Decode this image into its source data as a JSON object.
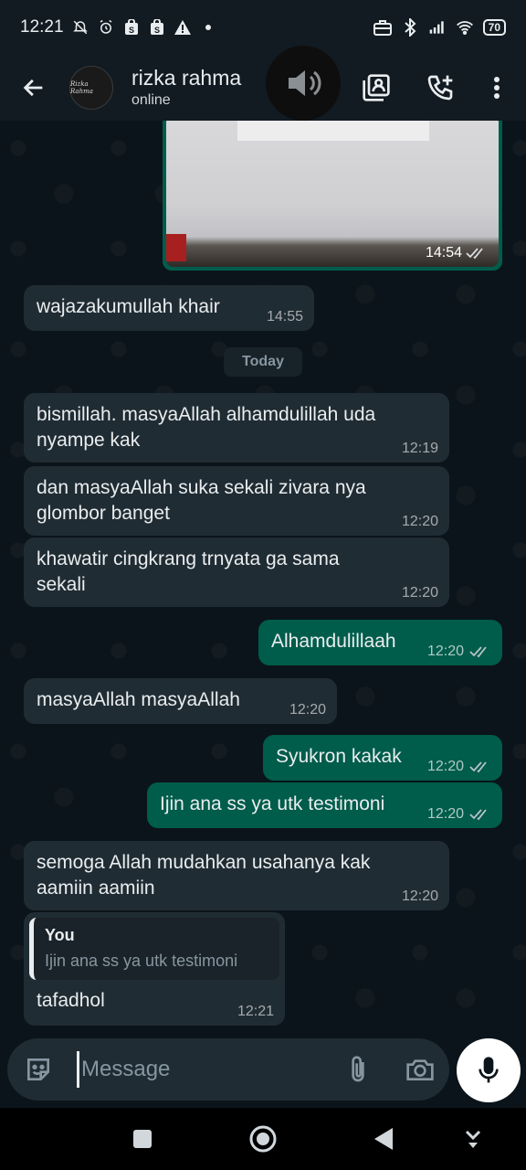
{
  "status_bar": {
    "time": "12:21",
    "battery": "70",
    "icons": [
      "mute-icon",
      "alarm-icon",
      "shop-icon",
      "shop-icon",
      "warning-icon",
      "dot-icon",
      "briefcase-icon",
      "bluetooth-icon",
      "signal-icon",
      "wifi-icon",
      "battery-icon"
    ]
  },
  "header": {
    "contact_name": "rizka rahma",
    "status": "online",
    "avatar_text": "Rizka Rahma",
    "icons": [
      "back-arrow-icon",
      "speaker-icon",
      "contact-card-icon",
      "add-call-icon",
      "more-vert-icon"
    ]
  },
  "chat": {
    "image_message": {
      "time": "14:54",
      "status": "read"
    },
    "messages": [
      {
        "dir": "in",
        "text": "wajazakumullah khair",
        "time": "14:55"
      },
      {
        "dir": "in",
        "text": "bismillah. masyaAllah alhamdulillah uda nyampe kak",
        "time": "12:19"
      },
      {
        "dir": "in",
        "text": "dan masyaAllah suka sekali zivara nya glombor banget",
        "time": "12:20"
      },
      {
        "dir": "in",
        "text": "khawatir cingkrang trnyata ga sama sekali",
        "time": "12:20"
      },
      {
        "dir": "out",
        "text": "Alhamdulillaah",
        "time": "12:20"
      },
      {
        "dir": "in",
        "text": "masyaAllah masyaAllah",
        "time": "12:20"
      },
      {
        "dir": "out",
        "text": "Syukron kakak",
        "time": "12:20"
      },
      {
        "dir": "out",
        "text": "Ijin ana ss ya utk testimoni",
        "time": "12:20"
      },
      {
        "dir": "in",
        "text": "semoga Allah mudahkan usahanya kak aamiin aamiin",
        "time": "12:20"
      },
      {
        "dir": "in",
        "text": "tafadhol",
        "time": "12:21",
        "quote": {
          "author": "You",
          "text": "Ijin ana ss ya utk testimoni"
        }
      }
    ],
    "date_divider": "Today"
  },
  "input": {
    "placeholder": "Message",
    "value": "",
    "icons": [
      "emoji-icon",
      "attach-icon",
      "camera-icon",
      "mic-icon"
    ]
  },
  "nav": {
    "icons": [
      "recents-square-icon",
      "home-circle-icon",
      "back-triangle-icon",
      "keyboard-hide-icon"
    ]
  },
  "colors": {
    "background": "#0b141a",
    "bar": "#121b22",
    "incoming": "#202c33",
    "outgoing": "#005c4b",
    "meta": "#8696a0"
  }
}
